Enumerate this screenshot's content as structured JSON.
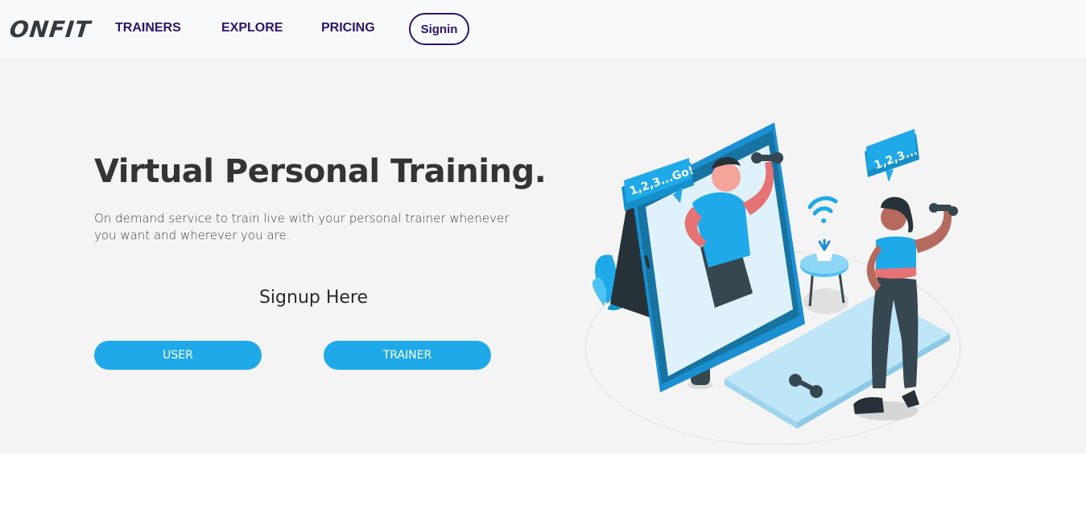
{
  "nav": {
    "logo": "ONFIT",
    "links": [
      "TRAINERS",
      "EXPLORE",
      "PRICING"
    ],
    "signin_label": "Signin"
  },
  "hero": {
    "title": "Virtual Personal Training.",
    "description": "On demand service to train live with your personal trainer whenever you want and wherever you are.",
    "signup_heading": "Signup Here",
    "user_button": "USER",
    "trainer_button": "TRAINER"
  },
  "illustration": {
    "bubble_left": "1,2,3...Go!",
    "bubble_right": "1,2,3..."
  },
  "colors": {
    "accent": "#1fa9e8",
    "nav_text": "#2e1468",
    "hero_bg": "#f4f4f4"
  }
}
